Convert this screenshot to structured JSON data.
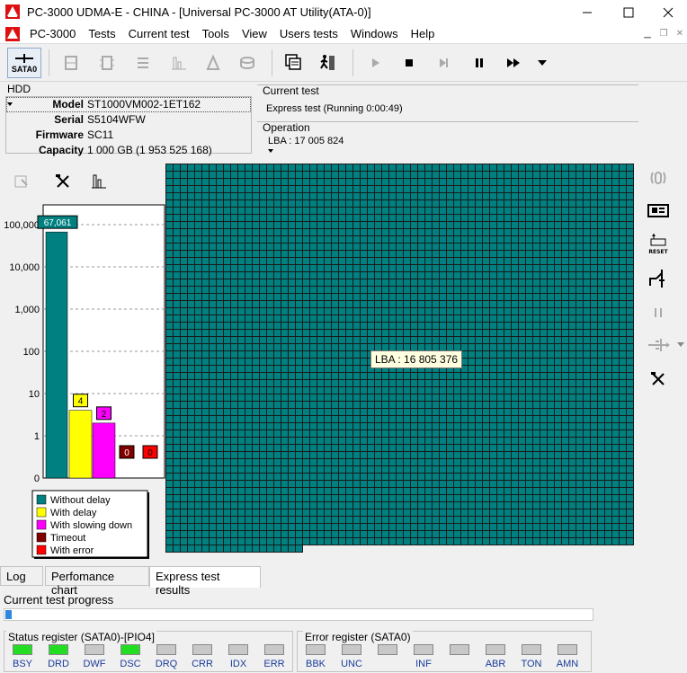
{
  "window": {
    "title": "PC-3000 UDMA-E - CHINA - [Universal PC-3000 AT Utility(ATA-0)]"
  },
  "menu": [
    "PC-3000",
    "Tests",
    "Current test",
    "Tools",
    "View",
    "Users tests",
    "Windows",
    "Help"
  ],
  "toolbar": {
    "sata_label": "SATA0"
  },
  "hdd": {
    "legend": "HDD",
    "fields": [
      {
        "key": "Model",
        "value": "ST1000VM002-1ET162"
      },
      {
        "key": "Serial",
        "value": "S5104WFW"
      },
      {
        "key": "Firmware",
        "value": "SC11"
      },
      {
        "key": "Capacity",
        "value": "1 000 GB (1 953 525 168)"
      }
    ]
  },
  "current_test": {
    "title": "Current test",
    "value": "Express test (Running 0:00:49)"
  },
  "operation": {
    "title": "Operation",
    "value": "LBA : 17 005 824"
  },
  "chart_data": {
    "type": "bar",
    "scale": "log",
    "categories": [
      "Without delay",
      "With delay",
      "With slowing down",
      "Timeout",
      "With error"
    ],
    "values": [
      67061,
      4,
      2,
      0,
      0
    ],
    "value_labels": [
      "67,061",
      "4",
      "2",
      "0",
      "0"
    ],
    "colors": [
      "#008080",
      "#ffff00",
      "#ff00ff",
      "#800000",
      "#ff0000"
    ],
    "y_ticks": [
      "0",
      "1",
      "10",
      "100",
      "1,000",
      "10,000",
      "100,000"
    ],
    "legend": [
      "Without delay",
      "With delay",
      "With slowing down",
      "Timeout",
      "With error"
    ]
  },
  "grid": {
    "color": "#008080",
    "tooltip": "LBA : 16 805 376"
  },
  "tabs": [
    "Log",
    "Perfomance chart",
    "Express test results"
  ],
  "progress": {
    "label": "Current test progress",
    "fraction": 0.01
  },
  "status_register": {
    "title": "Status register (SATA0)-[PIO4]",
    "bits": [
      {
        "name": "BSY",
        "on": true
      },
      {
        "name": "DRD",
        "on": true
      },
      {
        "name": "DWF",
        "on": false
      },
      {
        "name": "DSC",
        "on": true
      },
      {
        "name": "DRQ",
        "on": false
      },
      {
        "name": "CRR",
        "on": false
      },
      {
        "name": "IDX",
        "on": false
      },
      {
        "name": "ERR",
        "on": false
      }
    ]
  },
  "error_register": {
    "title": "Error register (SATA0)",
    "bits": [
      {
        "name": "BBK",
        "on": false
      },
      {
        "name": "UNC",
        "on": false
      },
      {
        "name": "",
        "on": false
      },
      {
        "name": "INF",
        "on": false
      },
      {
        "name": "",
        "on": false
      },
      {
        "name": "ABR",
        "on": false
      },
      {
        "name": "TON",
        "on": false
      },
      {
        "name": "AMN",
        "on": false
      }
    ]
  },
  "colors": {
    "led_on": "#22dd22",
    "led_off": "#c8c8c8",
    "accent": "#008080"
  }
}
